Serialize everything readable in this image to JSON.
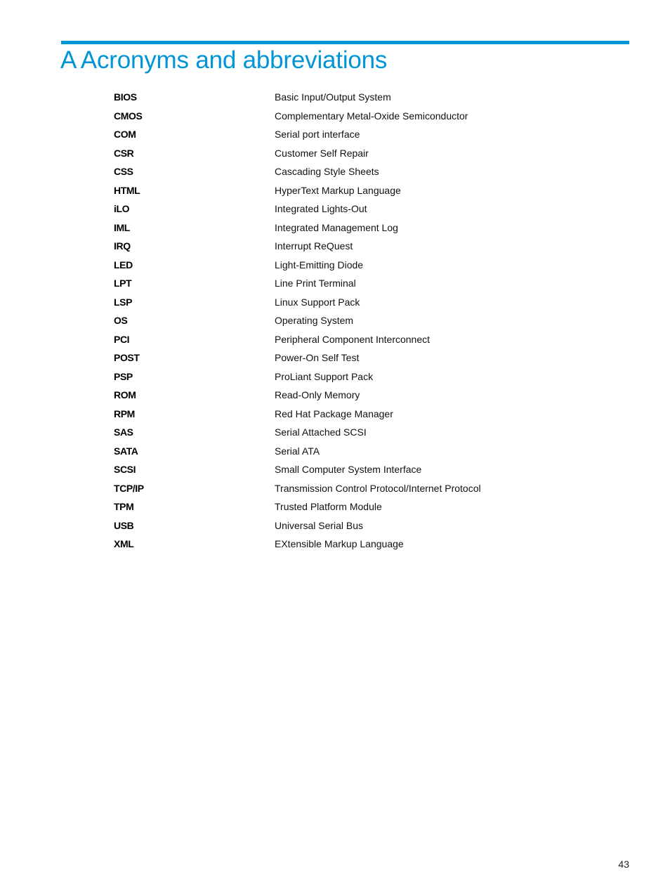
{
  "heading": {
    "title": "A Acronyms and abbreviations",
    "accent_color": "#0096d6"
  },
  "glossary": [
    {
      "term": "BIOS",
      "definition": "Basic Input/Output System"
    },
    {
      "term": "CMOS",
      "definition": "Complementary Metal-Oxide Semiconductor"
    },
    {
      "term": "COM",
      "definition": "Serial port interface"
    },
    {
      "term": "CSR",
      "definition": "Customer Self Repair"
    },
    {
      "term": "CSS",
      "definition": "Cascading Style Sheets"
    },
    {
      "term": "HTML",
      "definition": "HyperText Markup Language"
    },
    {
      "term": "iLO",
      "definition": "Integrated Lights-Out"
    },
    {
      "term": "IML",
      "definition": "Integrated Management Log"
    },
    {
      "term": "IRQ",
      "definition": "Interrupt ReQuest"
    },
    {
      "term": "LED",
      "definition": "Light-Emitting Diode"
    },
    {
      "term": "LPT",
      "definition": "Line Print Terminal"
    },
    {
      "term": "LSP",
      "definition": "Linux Support Pack"
    },
    {
      "term": "OS",
      "definition": "Operating System"
    },
    {
      "term": "PCI",
      "definition": "Peripheral Component Interconnect"
    },
    {
      "term": "POST",
      "definition": "Power-On Self Test"
    },
    {
      "term": "PSP",
      "definition": "ProLiant Support Pack"
    },
    {
      "term": "ROM",
      "definition": "Read-Only Memory"
    },
    {
      "term": "RPM",
      "definition": "Red Hat Package Manager"
    },
    {
      "term": "SAS",
      "definition": "Serial Attached SCSI"
    },
    {
      "term": "SATA",
      "definition": "Serial ATA"
    },
    {
      "term": "SCSI",
      "definition": "Small Computer System Interface"
    },
    {
      "term": "TCP/IP",
      "definition": "Transmission Control Protocol/Internet Protocol"
    },
    {
      "term": "TPM",
      "definition": "Trusted Platform Module"
    },
    {
      "term": "USB",
      "definition": "Universal Serial Bus"
    },
    {
      "term": "XML",
      "definition": "EXtensible Markup Language"
    }
  ],
  "footer": {
    "page_number": "43"
  }
}
